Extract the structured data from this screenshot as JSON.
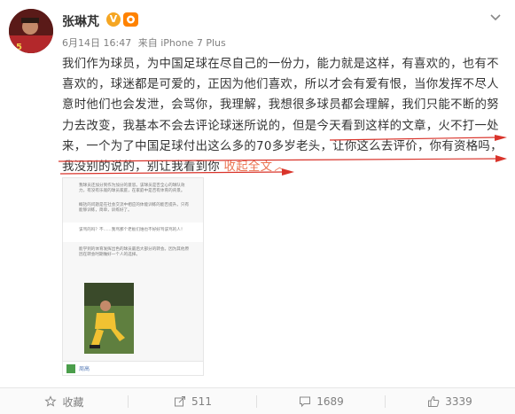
{
  "user": {
    "name": "张琳芃",
    "v_badge": "V"
  },
  "meta": {
    "date": "6月14日 16:47",
    "source": "来自 iPhone 7 Plus"
  },
  "post": {
    "text_main": "我们作为球员，为中国足球在尽自己的一份力，能力就是这样，有喜欢的，也有不喜欢的，球迷都是可爱的，正因为他们喜欢，所以才会有爱有恨，当你发挥不尽人意时他们也会发泄，会骂你，我理解，我想很多球员都会理解，我们只能不断的努力去改变，我基本不会去评论球迷所说的，但是今天看到这样的文章，火不打一处来，一个为了中国足球付出这么多的70多岁老头，让你这么去评价，你有资格吗，我没别的说的，别让我看到你",
    "collapse_label": "收起全文",
    "collapse_arrow": "︿"
  },
  "embed": {
    "para1": "我球员还加分到作为加分的意思。该球员是否全心的球队效力，有没有乐观的球员家庭，在家庭中是否有体育的背景。",
    "para2": "概括的问题是在社会交流中相应的体能训练的能否提升。只有能够训练，简单，训练好了。",
    "quote": "该骂的吗？不……我骂那个老板们谁也不好好骂该骂的人！",
    "para3": "能学到的体育发挥出色的球员最后大部分的转会。因为其他原因在转会时期做好一个人的选择。",
    "footer_name": "周高"
  },
  "actions": {
    "favorite_label": "收藏",
    "share_count": "511",
    "comment_count": "1689",
    "like_count": "3339"
  },
  "colors": {
    "link": "#eb7350",
    "underline": "#d9342b",
    "name_badge": "#f5a623",
    "member_badge": "#ff8200"
  },
  "icons": {
    "chevron": "chevron-down-icon",
    "favorite": "star-icon",
    "share": "share-icon",
    "comment": "comment-icon",
    "like": "thumbs-up-icon"
  }
}
